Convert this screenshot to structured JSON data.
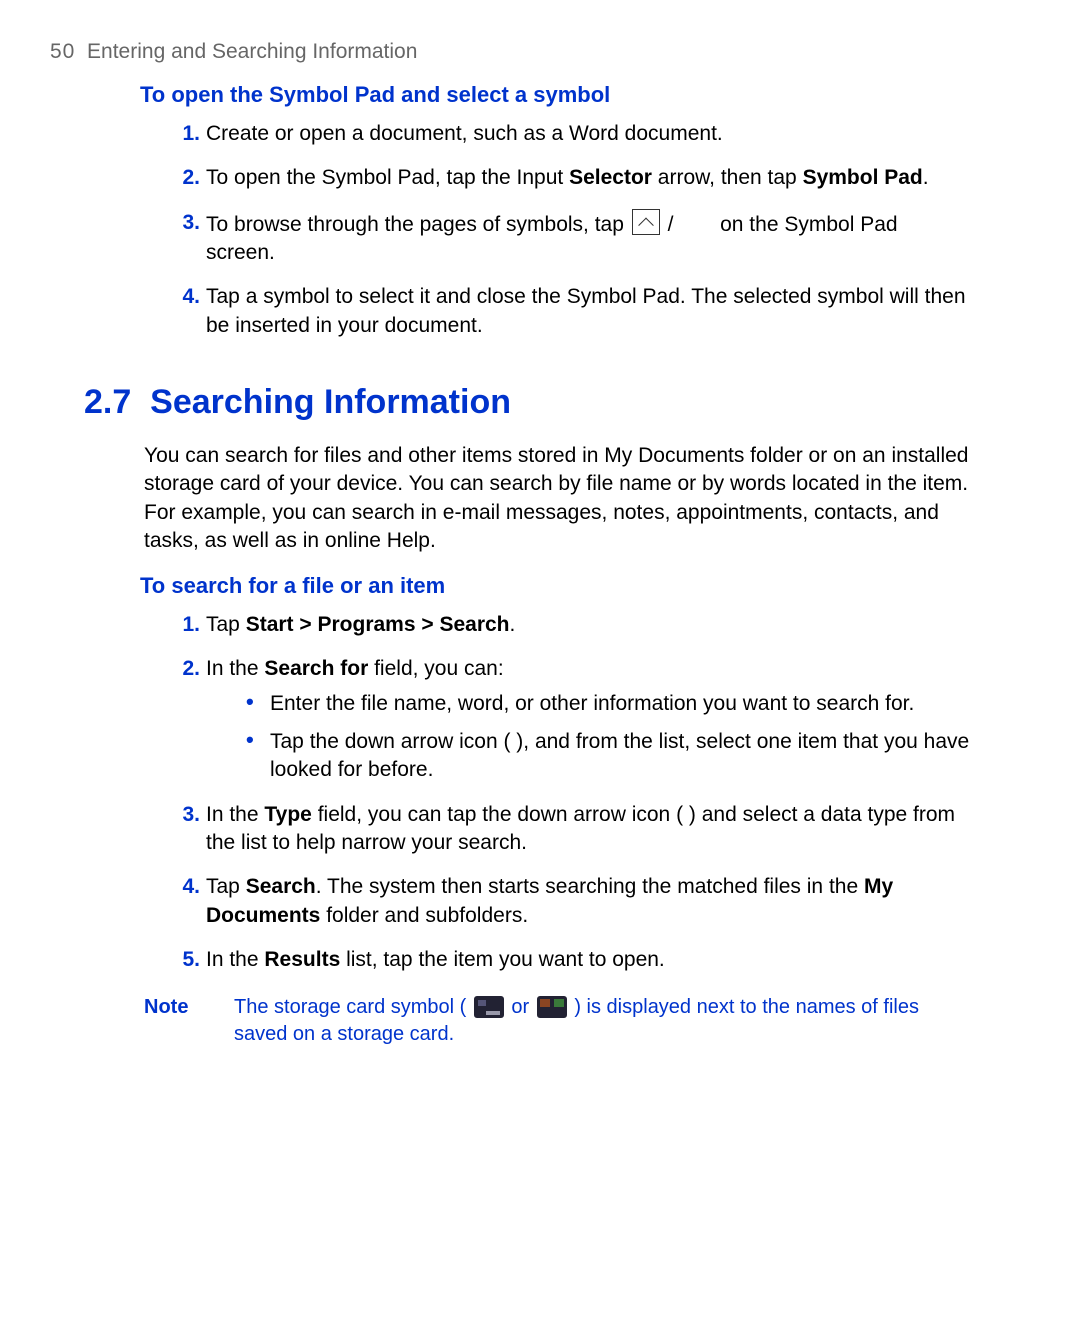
{
  "header": {
    "page_number": "50",
    "chapter": "Entering and Searching Information"
  },
  "sectionA": {
    "subhead": "To open the Symbol Pad and select a symbol",
    "steps": {
      "s1": {
        "num": "1.",
        "text": "Create or open a document, such as a Word document."
      },
      "s2": {
        "num": "2.",
        "pre": "To open the Symbol Pad, tap the Input ",
        "bold1": "Selector",
        "mid": " arrow, then tap ",
        "bold2": "Symbol Pad",
        "post": "."
      },
      "s3": {
        "num": "3.",
        "pre": "To browse through the pages of symbols, tap ",
        "slash": " / ",
        "post": " on the Symbol Pad screen."
      },
      "s4": {
        "num": "4.",
        "text": "Tap a symbol to select it and close the Symbol Pad. The selected symbol will then be inserted in your document."
      }
    }
  },
  "sectionB": {
    "heading_num": "2.7",
    "heading_title": "Searching Information",
    "intro": "You can search for files and other items stored in My Documents folder or on an installed storage card of your device. You can search by file name or by words located in the item. For example, you can search in e-mail messages, notes, appointments, contacts, and tasks, as well as in online Help.",
    "subhead": "To search for a file or an item",
    "steps": {
      "s1": {
        "num": "1.",
        "pre": "Tap ",
        "bold": "Start > Programs > Search",
        "post": "."
      },
      "s2": {
        "num": "2.",
        "pre": "In the ",
        "bold": "Search for",
        "post": " field, you can:",
        "bullets": {
          "b1": "Enter the file name, word, or other information you want to search for.",
          "b2": "Tap the down arrow icon (      ), and from the list, select one item that you have looked for before."
        }
      },
      "s3": {
        "num": "3.",
        "pre": "In the ",
        "bold": "Type",
        "post": " field, you can tap the down arrow icon (      ) and select a data type from the list to help narrow your search."
      },
      "s4": {
        "num": "4.",
        "pre": "Tap ",
        "bold1": "Search",
        "mid": ". The system then starts searching the matched files in the ",
        "bold2": "My Documents",
        "post": " folder and subfolders."
      },
      "s5": {
        "num": "5.",
        "pre": "In the ",
        "bold": "Results",
        "post": " list, tap the item you want to open."
      }
    },
    "note": {
      "label": "Note",
      "pre": "The storage card symbol ( ",
      "or": " or ",
      "post": " ) is displayed next to the names of files saved on a storage card."
    }
  }
}
